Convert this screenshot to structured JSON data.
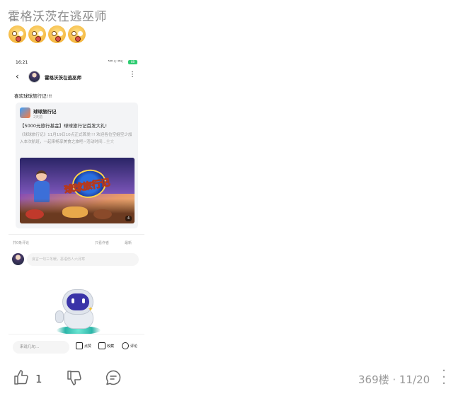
{
  "post": {
    "title": "霍格沃茨在逃巫师",
    "emoji_icons": [
      "astonished-face-icon",
      "astonished-face-icon",
      "astonished-face-icon",
      "astonished-face-icon"
    ]
  },
  "screenshot": {
    "status": {
      "time": "16:21",
      "signal": "⁵⁶ᴳ ᵃᵢˡ ⁴ᴳᵃᵢˡ",
      "battery": "88"
    },
    "topbar": {
      "user_name": "霍格沃茨在逃巫师"
    },
    "content_text": "喜欢球球旅行记!!!",
    "card": {
      "game_name": "球球旅行记",
      "time": "2天前",
      "headline": "【5000元旅行基金】球球旅行记首发大礼!",
      "body": "《球球旅行记》11月19日10点正式首发!!! 欢迎各位空姐空少加入本次航班，一起来畅享美食之旅吧~活动时间",
      "more_link": "...全文",
      "image_logo": "球球旅行记",
      "image_count": "4"
    },
    "comments": {
      "count_label": "共0条评论",
      "only_author_label": "只看作者",
      "latest_label": "最新",
      "input_placeholder": "良言一句三冬暖，恶语伤人六月寒"
    },
    "bottom_bar": {
      "input_placeholder": "来说几句...",
      "like_label": "点赞",
      "collect_label": "收藏",
      "comment_label": "评论"
    }
  },
  "footer": {
    "like_count": "1",
    "floor_info": "369楼 · 11/20",
    "menu_icon": "more-vertical-icon"
  },
  "colors": {
    "accent_green": "#2ecc71",
    "muted_text": "#999999",
    "title_gray": "#8a8a8a"
  }
}
